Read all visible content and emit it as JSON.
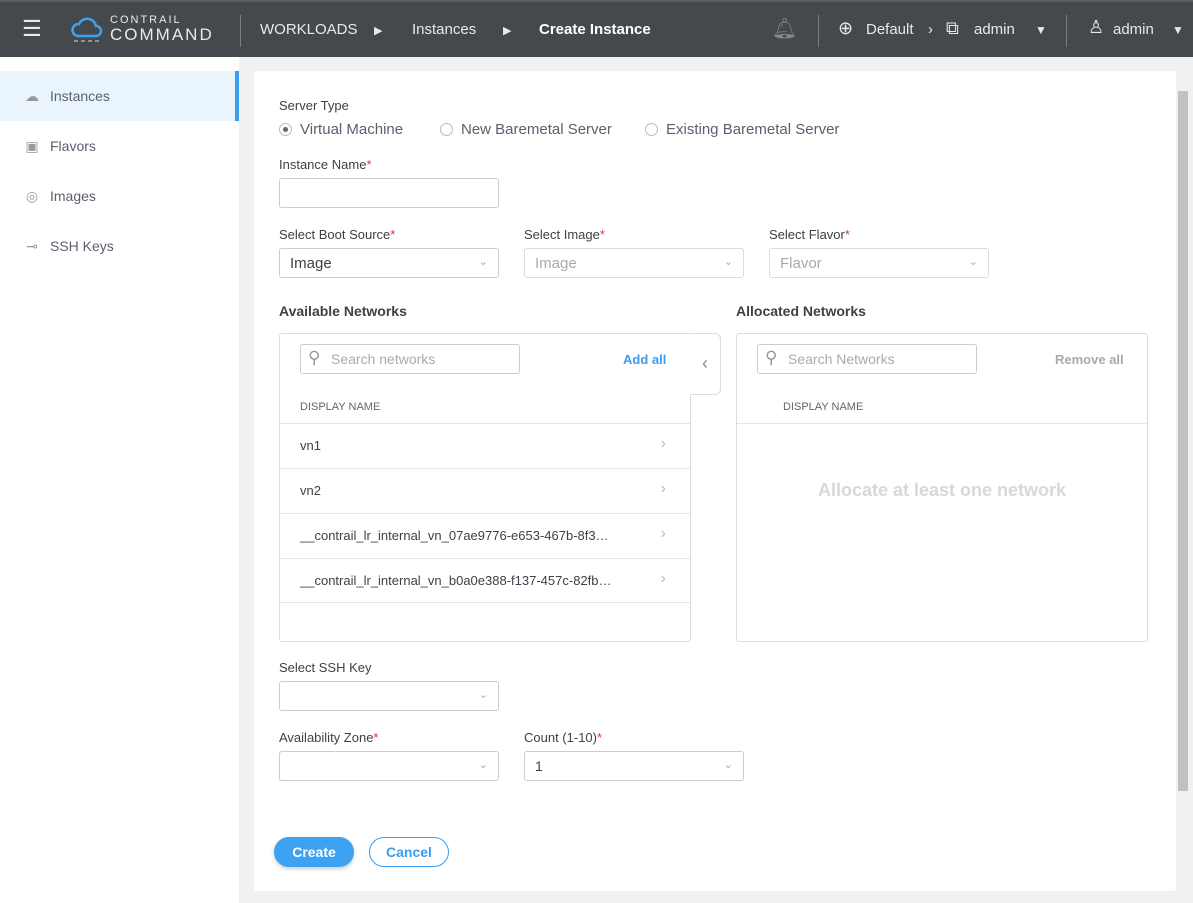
{
  "header": {
    "logo_top": "CONTRAIL",
    "logo_bottom": "COMMAND",
    "breadcrumb": [
      "WORKLOADS",
      "Instances",
      "Create Instance"
    ],
    "domain": "Default",
    "project": "admin",
    "user": "admin"
  },
  "sidebar": {
    "items": [
      {
        "label": "Instances",
        "icon": "instances-icon"
      },
      {
        "label": "Flavors",
        "icon": "flavor-icon"
      },
      {
        "label": "Images",
        "icon": "disc-icon"
      },
      {
        "label": "SSH Keys",
        "icon": "key-icon"
      }
    ]
  },
  "form": {
    "server_type_label": "Server Type",
    "server_types": [
      "Virtual Machine",
      "New Baremetal Server",
      "Existing Baremetal Server"
    ],
    "instance_name_label": "Instance Name",
    "instance_name_value": "",
    "boot_source_label": "Select Boot Source",
    "boot_source_value": "Image",
    "image_label": "Select Image",
    "image_placeholder": "Image",
    "flavor_label": "Select Flavor",
    "flavor_placeholder": "Flavor",
    "available_title": "Available Networks",
    "available_search": "Search networks",
    "add_all": "Add all",
    "display_name": "DISPLAY NAME",
    "networks": [
      "vn1",
      "vn2",
      "__contrail_lr_internal_vn_07ae9776-e653-467b-8f3…",
      "__contrail_lr_internal_vn_b0a0e388-f137-457c-82fb…"
    ],
    "allocated_title": "Allocated Networks",
    "allocated_search": "Search Networks",
    "remove_all": "Remove all",
    "allocated_empty": "Allocate at least one network",
    "ssh_label": "Select SSH Key",
    "az_label": "Availability Zone",
    "count_label": "Count (1-10)",
    "count_value": "1",
    "required": "*",
    "create": "Create",
    "cancel": "Cancel"
  }
}
